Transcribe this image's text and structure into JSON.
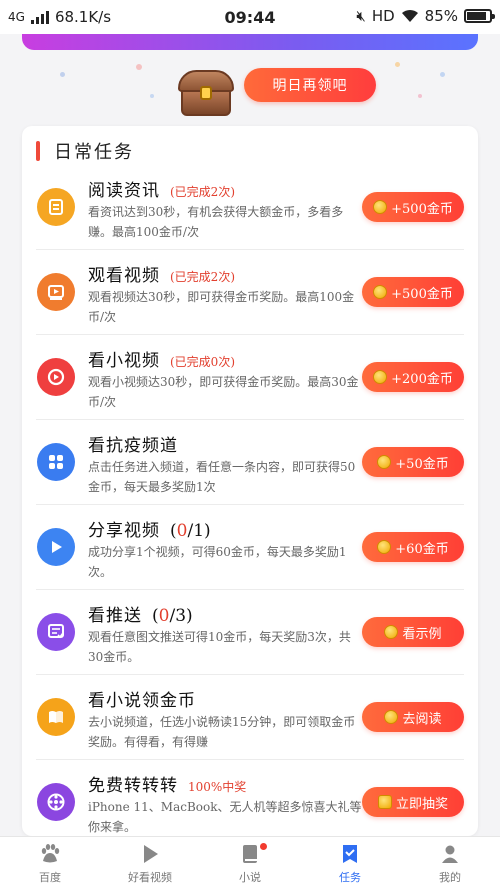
{
  "status_bar": {
    "signal": "4G",
    "speed": "68.1K/s",
    "time": "09:44",
    "network": "HD",
    "battery": "85%"
  },
  "reward": {
    "claim_label": "明日再领吧"
  },
  "daily": {
    "title": "日常任务",
    "tasks": [
      {
        "title": "阅读资讯",
        "status": "(已完成2次)",
        "desc": "看资讯达到30秒，有机会获得大额金币，多看多赚。最高100金币/次",
        "button": "+500金币",
        "icon": "news-icon",
        "color": "#f5a623"
      },
      {
        "title": "观看视频",
        "status": "(已完成2次)",
        "desc": "观看视频达30秒，即可获得金币奖励。最高100金币/次",
        "button": "+500金币",
        "icon": "video-icon",
        "color": "#f07c2e"
      },
      {
        "title": "看小视频",
        "status": "(已完成0次)",
        "desc": "观看小视频达30秒，即可获得金币奖励。最高30金币/次",
        "button": "+200金币",
        "icon": "short-video-icon",
        "color": "#ef3f3f"
      },
      {
        "title": "看抗疫频道",
        "desc": "点击任务进入频道，看任意一条内容，即可获得50金币，每天最多奖励1次",
        "button": "+50金币",
        "icon": "grid-icon",
        "color": "#3a7cf0"
      },
      {
        "title": "分享视频",
        "progress_done": "0",
        "progress_total": "/1",
        "desc": "成功分享1个视频，可得60金币，每天最多奖励1次。",
        "button": "+60金币",
        "icon": "play-icon",
        "color": "#3d84f2"
      },
      {
        "title": "看推送",
        "progress_done": "0",
        "progress_total": "/3",
        "desc": "观看任意图文推送可得10金币，每天奖励3次，共30金币。",
        "button": "看示例",
        "icon": "message-icon",
        "color": "#8a4ee8"
      },
      {
        "title": "看小说领金币",
        "desc": "去小说频道，任选小说畅读15分钟，即可领取金币奖励。有得看，有得赚",
        "button": "去阅读",
        "icon": "book-icon",
        "color": "#f5a31a"
      },
      {
        "title": "免费转转转",
        "status": "100%中奖",
        "desc": "iPhone 11、MacBook、无人机等超多惊喜大礼等你来拿。",
        "button": "立即抽奖",
        "icon": "wheel-icon",
        "color": "#8b46e0"
      }
    ]
  },
  "tabbar": {
    "items": [
      {
        "label": "百度"
      },
      {
        "label": "好看视频"
      },
      {
        "label": "小说"
      },
      {
        "label": "任务"
      },
      {
        "label": "我的"
      }
    ]
  }
}
